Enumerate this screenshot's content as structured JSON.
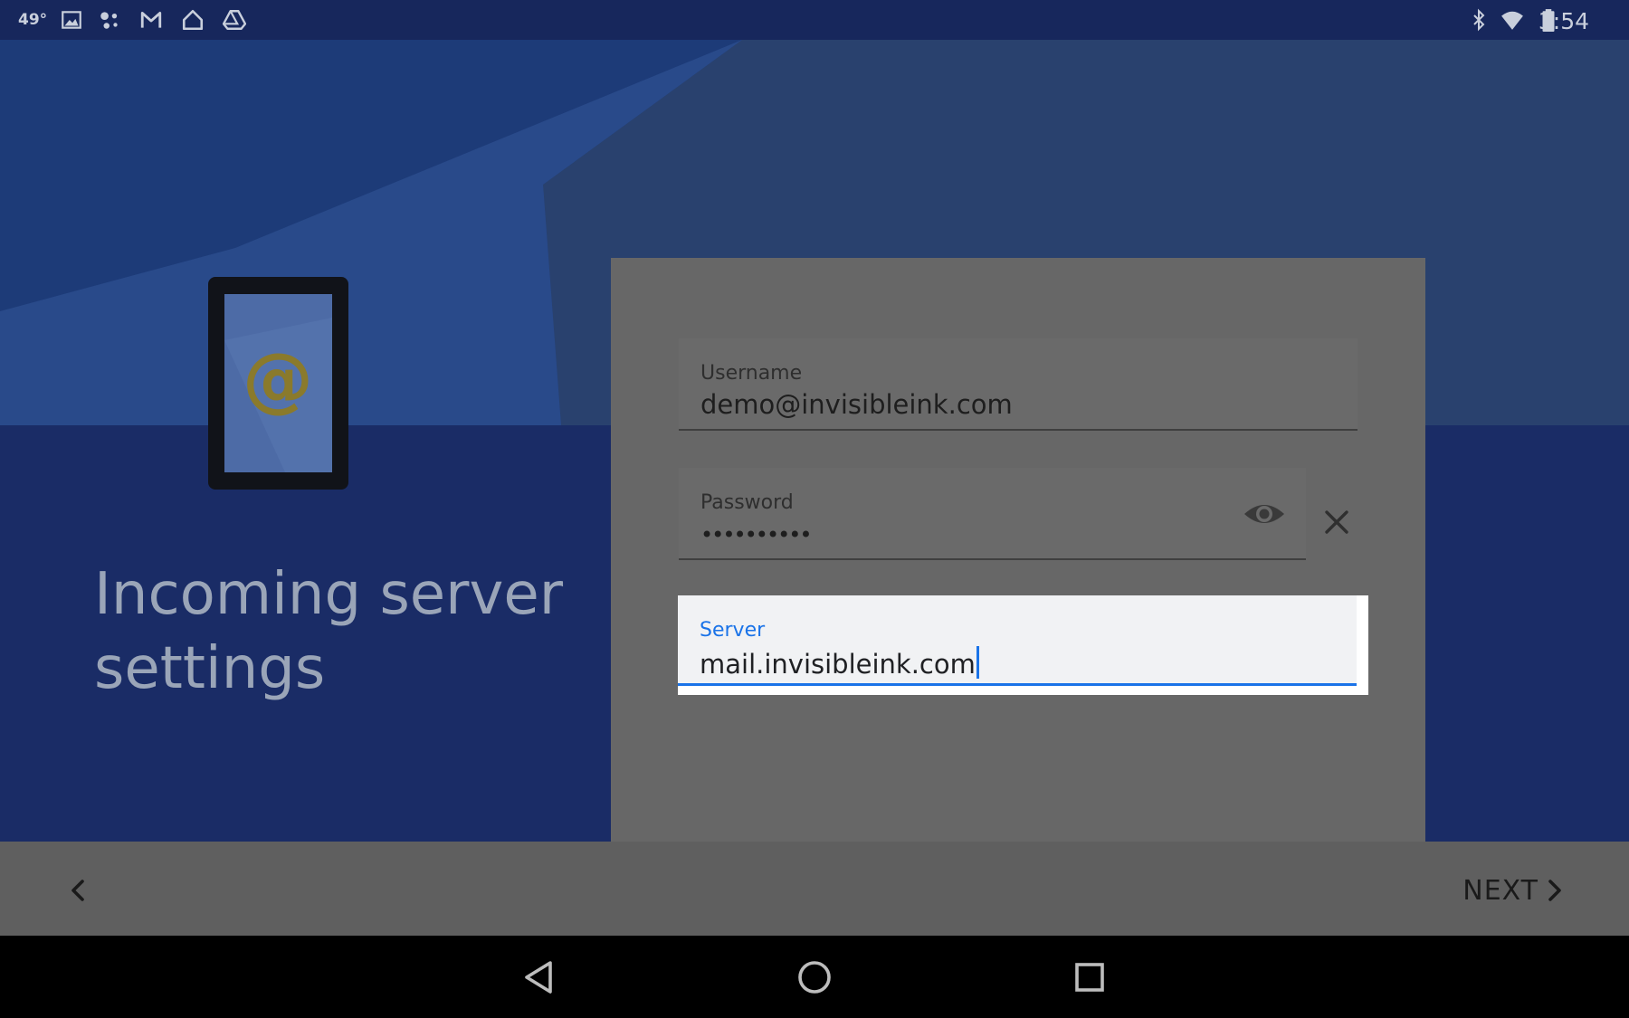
{
  "status_bar": {
    "temperature": "49°",
    "time": "3:54",
    "left_icons": [
      "image-icon",
      "assistant-dots-icon",
      "gmail-icon",
      "home-icon",
      "drive-icon"
    ],
    "right_icons": [
      "bluetooth-icon",
      "wifi-icon",
      "battery-icon"
    ]
  },
  "page": {
    "heading": "Incoming server settings",
    "illustration": "tablet-at-sign-illustration"
  },
  "form": {
    "username": {
      "label": "Username",
      "value": "demo@invisibleink.com"
    },
    "password": {
      "label": "Password",
      "value": "••••••••••"
    },
    "server": {
      "label": "Server",
      "value": "mail.invisibleink.com"
    }
  },
  "footer": {
    "next_label": "NEXT"
  },
  "colors": {
    "accent": "#1a73e8",
    "backdrop_dark": "#17275c",
    "card": "#676767",
    "footer": "#5f5f5f"
  }
}
